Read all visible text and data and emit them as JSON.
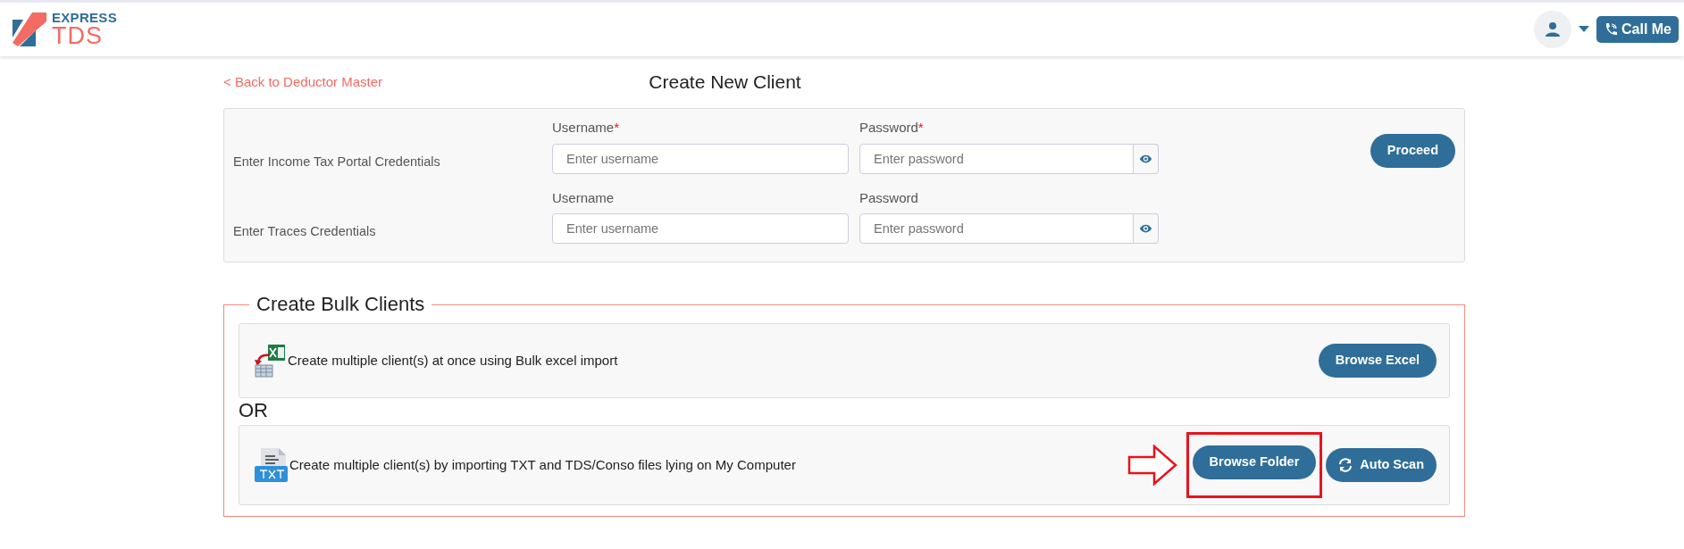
{
  "header": {
    "logo": {
      "top": "EXPRESS",
      "bottom": "TDS"
    },
    "call_button": "Call Me"
  },
  "back_link": "< Back to Deductor Master",
  "title": "Create New Client",
  "credentials": [
    {
      "label": "Enter Income Tax Portal Credentials",
      "username": {
        "label": "Username",
        "mark": "*",
        "placeholder": "Enter username"
      },
      "password": {
        "label": "Password",
        "mark": "*",
        "placeholder": "Enter password"
      }
    },
    {
      "label": "Enter Traces Credentials",
      "username": {
        "label": "Username",
        "placeholder": "Enter username"
      },
      "password": {
        "label": "Password",
        "placeholder": "Enter password"
      }
    }
  ],
  "proceed_button": "Proceed",
  "bulk": {
    "legend": "Create Bulk Clients",
    "separator": "OR",
    "options": [
      {
        "kind": "excel",
        "text": "Create multiple client(s) at once using Bulk excel import",
        "buttons": [
          {
            "label": "Browse Excel",
            "kind": "plain",
            "highlighted": false
          }
        ]
      },
      {
        "kind": "txt",
        "text": "Create multiple client(s) by importing TXT and TDS/Conso files lying on My Computer",
        "buttons": [
          {
            "label": "Browse Folder",
            "kind": "plain",
            "highlighted": true
          },
          {
            "label": "Auto Scan",
            "kind": "scan",
            "highlighted": false
          }
        ]
      }
    ]
  }
}
